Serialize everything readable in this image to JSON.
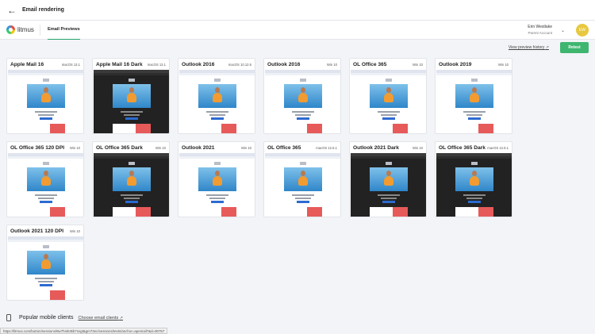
{
  "window": {
    "back_icon": "arrow-left-icon",
    "title": "Email rendering"
  },
  "nav": {
    "logo_text": "litmus",
    "tab": "Email Previews",
    "user_name": "Erin Westlake",
    "user_sub": "Parent Account",
    "avatar_initials": "EW",
    "avatar_color": "#e8c840"
  },
  "actions": {
    "history_link": "View preview history",
    "retest": "Retest"
  },
  "cards": [
    {
      "client": "Apple Mail 16",
      "os": "macOS 13.1",
      "theme": "light"
    },
    {
      "client": "Apple Mail 16 Dark",
      "os": "macOS 13.1",
      "theme": "dark"
    },
    {
      "client": "Outlook 2016",
      "os": "macOS 10.12.6",
      "theme": "light"
    },
    {
      "client": "Outlook 2016",
      "os": "Win 10",
      "theme": "light"
    },
    {
      "client": "OL Office 365",
      "os": "Win 10",
      "theme": "light"
    },
    {
      "client": "Outlook 2019",
      "os": "Win 10",
      "theme": "light"
    },
    {
      "client": "OL Office 365 120 DPI",
      "os": "Win 10",
      "theme": "light"
    },
    {
      "client": "OL Office 365 Dark",
      "os": "Win 10",
      "theme": "dark"
    },
    {
      "client": "Outlook 2021",
      "os": "Win 10",
      "theme": "light"
    },
    {
      "client": "OL Office 365",
      "os": "macOS 12.6.1",
      "theme": "light"
    },
    {
      "client": "Outlook 2021 Dark",
      "os": "Win 10",
      "theme": "dark"
    },
    {
      "client": "OL Office 365 Dark",
      "os": "macOS 12.6.1",
      "theme": "dark"
    },
    {
      "client": "Outlook 2021 120 DPI",
      "os": "Win 10",
      "theme": "light"
    }
  ],
  "mobile": {
    "title": "Popular mobile clients",
    "choose": "Choose email clients"
  },
  "status_url": "https://litmus.com/button/sessions/8w7hnIkrBb7svgt&gm73ec/sessions/tests/anchor=apemail?&d=90757"
}
